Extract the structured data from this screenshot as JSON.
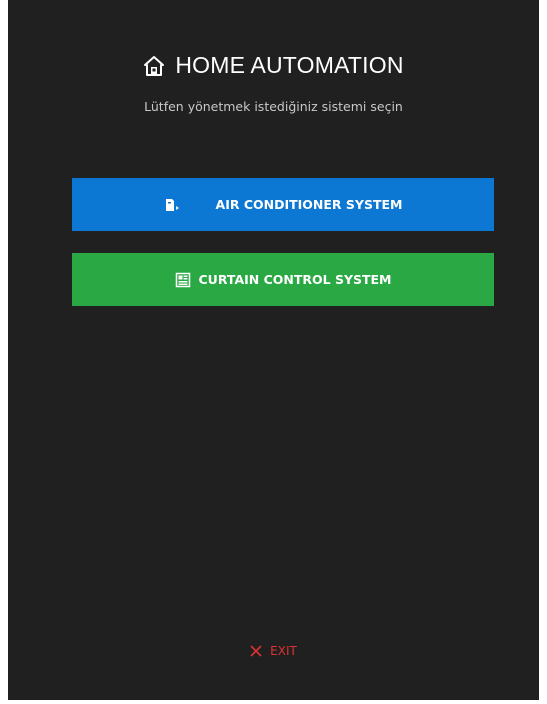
{
  "header": {
    "title": "HOME AUTOMATION",
    "subtitle": "Lütfen yönetmek istediğiniz sistemi seçin",
    "icon": "home-icon"
  },
  "buttons": [
    {
      "label": "AIR CONDITIONER SYSTEM",
      "icon": "air-conditioner-icon",
      "color": "#0d78d4"
    },
    {
      "label": "CURTAIN CONTROL SYSTEM",
      "icon": "curtain-icon",
      "color": "#2aa843"
    }
  ],
  "footer": {
    "exit_label": "EXIT",
    "exit_icon": "close-icon",
    "exit_color": "#e03131"
  },
  "colors": {
    "background": "#202020",
    "text": "#ffffff",
    "subtitle": "#c8c8c8"
  }
}
